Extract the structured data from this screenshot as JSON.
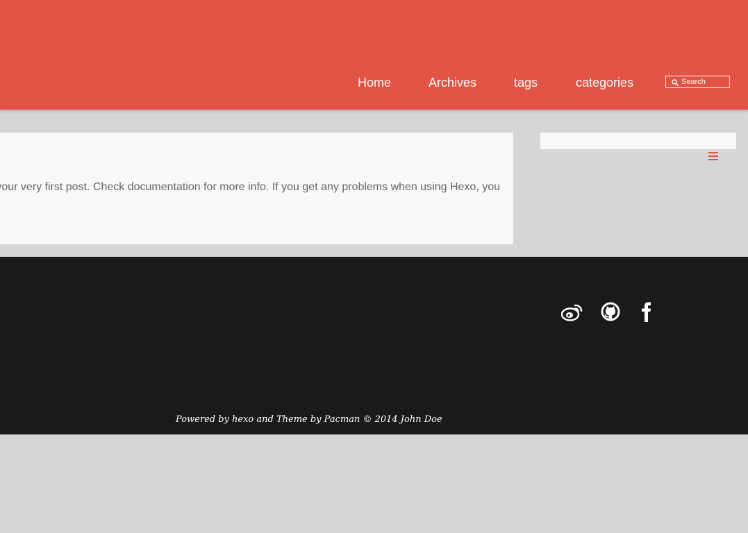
{
  "colors": {
    "accent": "#e35345",
    "page_background": "#d6d6d6",
    "card_background": "#f8f8f8",
    "footer_background": "#1a1a1a",
    "body_text": "#666666"
  },
  "nav": {
    "items": [
      {
        "label": "Home"
      },
      {
        "label": "Archives"
      },
      {
        "label": "tags"
      },
      {
        "label": "categories"
      }
    ]
  },
  "search": {
    "placeholder": "Search",
    "icon": "search-icon"
  },
  "post": {
    "excerpt": "Welcome to Hexo! This is your very first post. Check documentation for more info. If you get any problems when using Hexo, you"
  },
  "sidebar": {
    "menu_icon": "hamburger-menu-icon"
  },
  "footer": {
    "social": [
      {
        "icon": "weibo-icon"
      },
      {
        "icon": "github-icon"
      },
      {
        "icon": "facebook-icon"
      }
    ],
    "credit_prefix": "Powered by ",
    "credit_hexo": "hexo",
    "credit_middle": " and Theme by ",
    "credit_theme": "Pacman",
    "credit_suffix": " © 2014 John Doe"
  }
}
